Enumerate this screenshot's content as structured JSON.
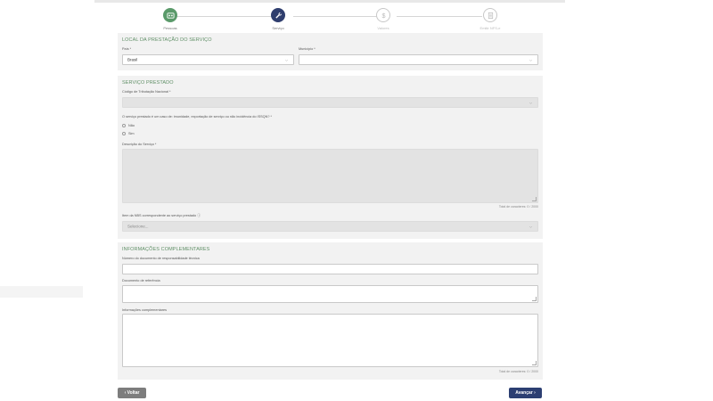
{
  "stepper": {
    "steps": [
      {
        "label": "Pessoas",
        "icon": "people-icon",
        "state": "done"
      },
      {
        "label": "Serviço",
        "icon": "wrench-icon",
        "state": "active"
      },
      {
        "label": "Valores",
        "icon": "dollar-icon",
        "state": "todo"
      },
      {
        "label": "Emitir NFS-e",
        "icon": "document-icon",
        "state": "todo"
      }
    ]
  },
  "local": {
    "title": "LOCAL DA PRESTAÇÃO DO SERVIÇO",
    "pais_label": "País *",
    "pais_value": "Brasil",
    "municipio_label": "Município *",
    "municipio_value": ""
  },
  "servico": {
    "title": "SERVIÇO PRESTADO",
    "codigo_label": "Código de Tributação Nacional *",
    "pergunta": "O serviço prestado é um caso de: imunidade, exportação de serviço ou não incidência do ISSQN? *",
    "opcoes": [
      "Não",
      "Sim"
    ],
    "descricao_label": "Descrição do Serviço *",
    "descricao_counter": "Total de caracteres: 0 / 2000",
    "nbs_label": "Item da NBS correspondente ao serviço prestado ⓘ",
    "nbs_placeholder": "Selecione..."
  },
  "complementares": {
    "title": "INFORMAÇÕES COMPLEMENTARES",
    "numero_label": "Número do documento de responsabilidade técnica",
    "documento_label": "Documento de referência",
    "info_label": "Informações complementares",
    "info_counter": "Total de caracteres: 0 / 2000"
  },
  "actions": {
    "back_label": "‹ Voltar",
    "next_label": "Avançar ›"
  },
  "colors": {
    "done": "#5a9a6a",
    "active": "#2f3e6e",
    "section_title": "#5f8f66",
    "next_button": "#2c3f72",
    "back_button": "#7d7d7d"
  }
}
